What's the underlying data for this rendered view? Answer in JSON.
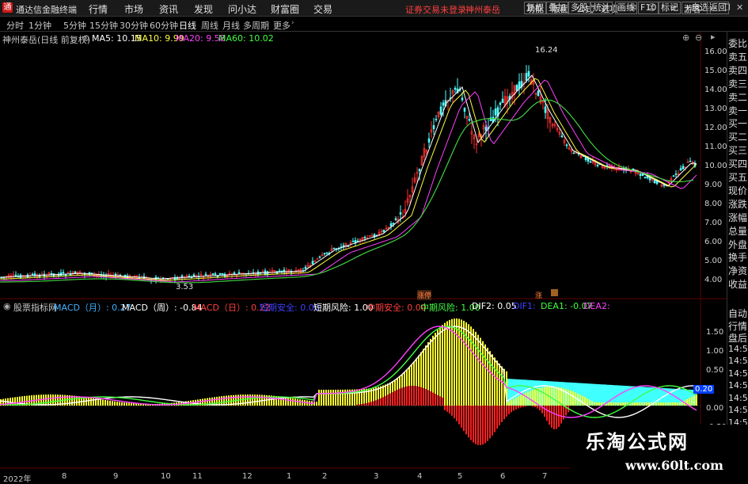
{
  "app": {
    "title": "通达信金融终端",
    "logo": "logo-icon"
  },
  "menu": [
    "行情",
    "市场",
    "资讯",
    "发现",
    "问小达",
    "财富圈",
    "交易"
  ],
  "notice": "证券交易未登录",
  "stock_name_top": "神州泰岳",
  "right_menu": [
    "功能",
    "版面",
    "公式",
    "选项"
  ],
  "guest": "游客",
  "periods": [
    "分时",
    "1分钟",
    "5分钟",
    "15分钟",
    "30分钟",
    "60分钟",
    "日线",
    "周线",
    "月线",
    "多周期",
    "更多"
  ],
  "active_period": "日线",
  "tools": [
    "复权",
    "叠加",
    "多股",
    "统计",
    "画线",
    "F10",
    "标记",
    "+自选",
    "返回"
  ],
  "main_title": "神州泰岳(日线 前复权)",
  "ma": [
    {
      "label": "MA5: 10.15",
      "color": "#ffffff"
    },
    {
      "label": "MA10: 9.99",
      "color": "#ffff40"
    },
    {
      "label": "MA20: 9.58",
      "color": "#ff40ff"
    },
    {
      "label": "MA60: 10.02",
      "color": "#40ff40"
    }
  ],
  "price_ticks": [
    "16.00",
    "15.00",
    "14.00",
    "13.00",
    "12.00",
    "11.00",
    "10.00",
    "9.00",
    "8.00",
    "7.00",
    "6.00",
    "5.00",
    "4.00"
  ],
  "high_label": "16.24",
  "low_label": "3.53",
  "marker_label": "涨停",
  "marker2_label": "涨",
  "right_panel": [
    "委比",
    "卖五",
    "卖四",
    "卖三",
    "卖二",
    "卖一",
    "买一",
    "买二",
    "买三",
    "买四",
    "买五",
    "现价",
    "涨跌",
    "涨幅",
    "总量",
    "外盘",
    "换手",
    "净资",
    "收益"
  ],
  "right_panel_lower": [
    "自动",
    "行情",
    "盘后",
    "14:50",
    "14:50",
    "14:50",
    "14:50",
    "14:50",
    "14:50",
    "14:50",
    "14:50"
  ],
  "indicator": {
    "name": "股票指标网",
    "items": [
      {
        "text": "MACD（月）: 0.27",
        "color": "#40b0ff"
      },
      {
        "text": "MACD（周）: -0.84",
        "color": "#ffffff"
      },
      {
        "text": "MACD（日）: 0.22",
        "color": "#ff4040"
      },
      {
        "text": "短期安全: 0.00",
        "color": "#4040ff"
      },
      {
        "text": "短期风险: 1.00",
        "color": "#ffffff"
      },
      {
        "text": "中期安全: 0.00",
        "color": "#ff4040"
      },
      {
        "text": "中期风险: 1.00",
        "color": "#40ff40"
      },
      {
        "text": "DIF2: 0.05",
        "color": "#ffffff"
      },
      {
        "text": "DIF1: ",
        "color": "#4040ff"
      },
      {
        "text": "DEA1: -0.07",
        "color": "#40ff40"
      },
      {
        "text": "DEA2: ",
        "color": "#ff40ff"
      }
    ]
  },
  "indicator_ticks": [
    "1.50",
    "1.00",
    "0.50",
    "0.20",
    "0.00",
    "-0.50"
  ],
  "x_labels": [
    "2022年",
    "8",
    "9",
    "10",
    "11",
    "12",
    "1",
    "2",
    "3",
    "4",
    "5",
    "6",
    "7"
  ],
  "watermark": {
    "title": "乐淘公式网",
    "url": "www.60lt.com"
  }
}
